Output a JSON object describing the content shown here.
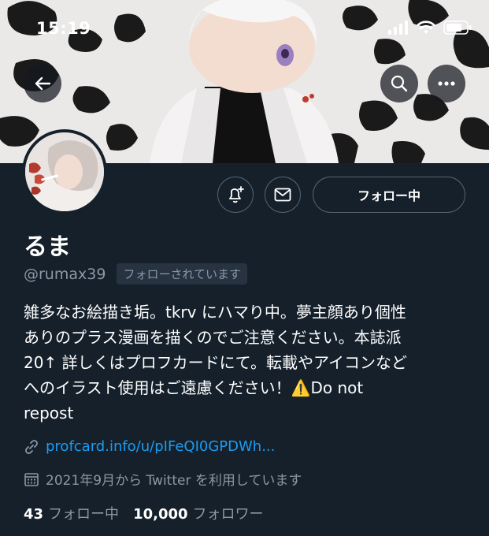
{
  "status_bar": {
    "time": "15:19"
  },
  "icons": {
    "back": "arrow-left-icon",
    "search": "search-icon",
    "more": "more-horizontal-icon",
    "notify": "bell-plus-icon",
    "message": "envelope-icon",
    "link": "link-icon",
    "calendar": "calendar-icon"
  },
  "profile": {
    "display_name": "るま",
    "handle": "@rumax39",
    "follows_you": "フォローされています",
    "follow_button": "フォロー中",
    "bio_lines": [
      "雑多なお絵描き垢。tkrv にハマり中。夢主顔あり個性",
      "ありのプラス漫画を描くのでご注意ください。本誌派",
      "20↑ 詳しくはプロフカードにて。転載やアイコンなど",
      "へのイラスト使用はご遠慮ください！",
      "⚠️",
      "Do not",
      "repost"
    ],
    "link": "profcard.info/u/pIFeQI0GPDWh...",
    "joined": "2021年9月から Twitter を利用しています",
    "following_count": "43",
    "following_label": "フォロー中",
    "followers_count": "10,000",
    "followers_label": "フォロワー"
  },
  "colors": {
    "background": "#15202b",
    "secondary_text": "#8b98a5",
    "link": "#1d9bf0",
    "border": "#536471"
  }
}
